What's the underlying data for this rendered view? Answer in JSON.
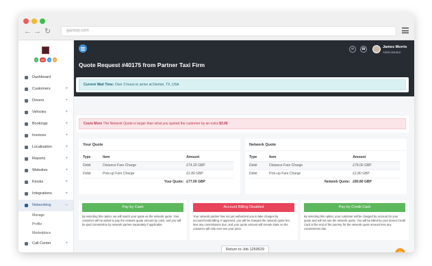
{
  "browser": {
    "url": "gazoop.com",
    "back_icon": "arrow-left-icon",
    "forward_icon": "arrow-right-icon",
    "reload_icon": "reload-icon",
    "menu_icon": "hamburger-icon"
  },
  "sidebar": {
    "badges": [
      {
        "label": "0",
        "color": "#3cb55c"
      },
      {
        "label": "68",
        "color": "#e04848"
      },
      {
        "label": "3",
        "color": "#3f95db"
      },
      {
        "label": "0",
        "color": "#f0a63a"
      }
    ],
    "items": [
      {
        "label": "Dashboard",
        "icon": "home-icon",
        "plus": ""
      },
      {
        "label": "Customers",
        "icon": "users-icon",
        "plus": "+"
      },
      {
        "label": "Drivers",
        "icon": "driver-icon",
        "plus": "+"
      },
      {
        "label": "Vehicles",
        "icon": "car-icon",
        "plus": "+"
      },
      {
        "label": "Bookings",
        "icon": "calendar-icon",
        "plus": "+"
      },
      {
        "label": "Invoices",
        "icon": "invoice-icon",
        "plus": "+"
      },
      {
        "label": "Localisation",
        "icon": "map-icon",
        "plus": "+"
      },
      {
        "label": "Reports",
        "icon": "chart-icon",
        "plus": "+"
      },
      {
        "label": "Websites",
        "icon": "globe-icon",
        "plus": "+"
      },
      {
        "label": "Kiosks",
        "icon": "kiosk-icon",
        "plus": "+"
      },
      {
        "label": "Integrations",
        "icon": "plug-icon",
        "plus": "+"
      },
      {
        "label": "Networking",
        "icon": "network-icon",
        "plus": "–"
      }
    ],
    "sub_items": [
      "Manage",
      "Profile",
      "Marketplace"
    ],
    "last_item": {
      "label": "Call Center",
      "icon": "phone-icon",
      "plus": "+"
    }
  },
  "topbar": {
    "user_name": "James Morris",
    "user_role": "Administrator",
    "mail_icon": "mail-icon",
    "phone_icon": "phone-icon"
  },
  "page": {
    "title": "Quote Request #40175 from Partner Taxi Firm"
  },
  "alerts": {
    "wait_label": "Current Wait Time:",
    "wait_text": " Over 3 hours to arrive at Denton, TX, USA",
    "cost_label": "Costs More",
    "cost_text": " The Network Quote is larger than what you quoted the customer by an extra ",
    "cost_amount": "$3.00"
  },
  "your_quote": {
    "heading": "Your Quote",
    "columns": [
      "Type",
      "Item",
      "Amount"
    ],
    "rows": [
      {
        "type": "Debit",
        "item": "Distance Fare Charge",
        "amount": "£74.20 GBP"
      },
      {
        "type": "Debit",
        "item": "Pick-up Fare Charge",
        "amount": "£2.80 GBP"
      }
    ],
    "total_label": "Your Quote:",
    "total_value": "£77.00 GBP"
  },
  "network_quote": {
    "heading": "Network Quote",
    "columns": [
      "Type",
      "Item",
      "Amount"
    ],
    "rows": [
      {
        "type": "Debit",
        "item": "Distance Fare Charge",
        "amount": "£78.00 GBP"
      },
      {
        "type": "Debit",
        "item": "Pick-up Fare Charge",
        "amount": "£2.80 GBP"
      }
    ],
    "total_label": "Network Quote:",
    "total_value": "£80.80 GBP"
  },
  "payments": [
    {
      "label": "Pay by Cash",
      "color": "#5cb85c",
      "desc": "By selecting this option, we will match your quote as the network quote. Your customer will be asked to pay the network quote amount by cash, and you will be paid commission by network partner separately if applicable."
    },
    {
      "label": "Account Billing Disabled",
      "color": "#e8445a",
      "desc": "Your network partner has not yet authorized you to take charges by account/credit billing. If approved, you will be charged the network quote fee, less any commissions due, and your quote amount will remain static so the customer will only ever see your price."
    },
    {
      "label": "Pay by Credit Card",
      "color": "#5cb85c",
      "desc": "By selecting this option, your customer will be charged by account for your quote and will not see the network quote. You will be billed by your stored Credit Card at the end of the journey for the network quote amount less any commissions due."
    }
  ],
  "return_button": "Return to Job 1259529",
  "chat_icon": "chat-icon"
}
